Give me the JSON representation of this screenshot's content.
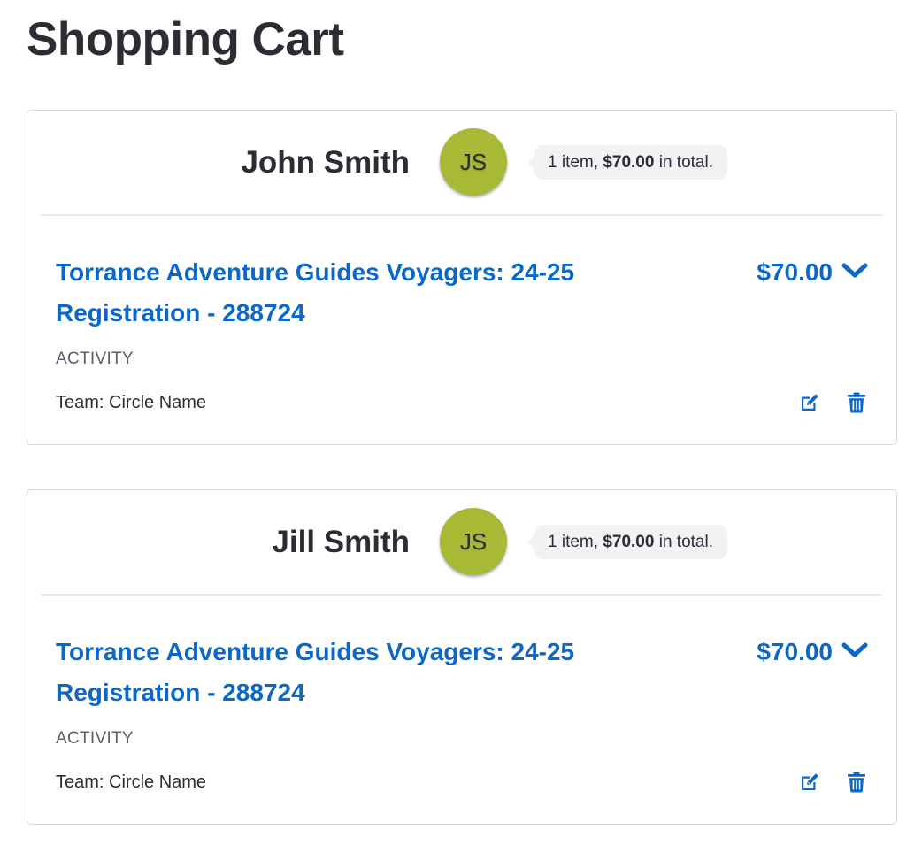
{
  "page": {
    "title": "Shopping Cart"
  },
  "colors": {
    "accent_blue": "#0b67c8",
    "avatar_green": "#a8b936",
    "text_dark": "#2b2d33",
    "text_muted": "#5a5e66",
    "summary_bg": "#f1f2f4"
  },
  "participants": [
    {
      "name": "John Smith",
      "initials": "JS",
      "summary_prefix": "1 item,",
      "summary_amount": "$70.00",
      "summary_suffix": "in total.",
      "item": {
        "title_line1": "Torrance Adventure Guides Voyagers: 24-25",
        "title_line2": "Registration - 288724",
        "price": "$70.00",
        "type": "ACTIVITY",
        "team": "Team: Circle Name",
        "expand_icon": "chevron-down-icon",
        "edit_icon": "edit-icon",
        "delete_icon": "trash-icon"
      }
    },
    {
      "name": "Jill Smith",
      "initials": "JS",
      "summary_prefix": "1 item,",
      "summary_amount": "$70.00",
      "summary_suffix": "in total.",
      "item": {
        "title_line1": "Torrance Adventure Guides Voyagers: 24-25",
        "title_line2": "Registration - 288724",
        "price": "$70.00",
        "type": "ACTIVITY",
        "team": "Team: Circle Name",
        "expand_icon": "chevron-down-icon",
        "edit_icon": "edit-icon",
        "delete_icon": "trash-icon"
      }
    }
  ]
}
